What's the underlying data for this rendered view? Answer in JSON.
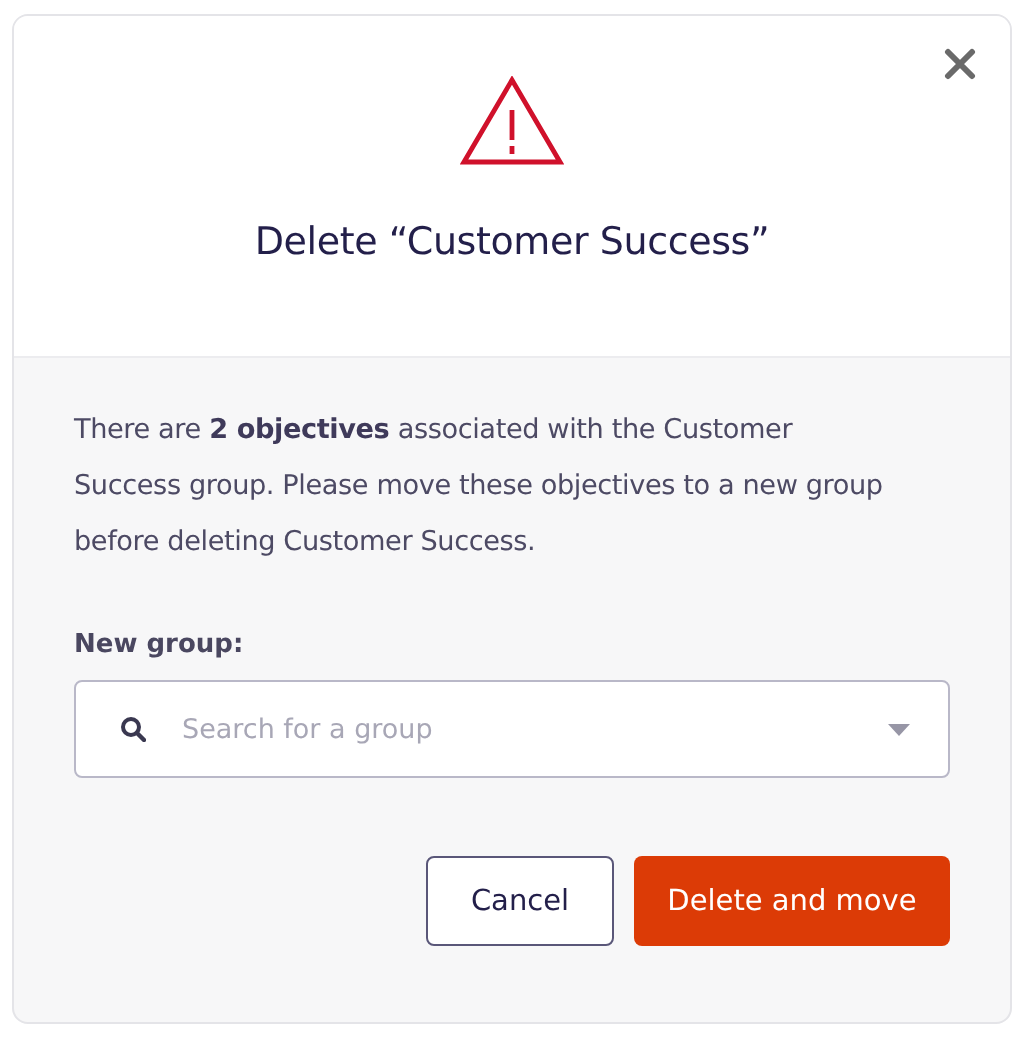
{
  "dialog": {
    "title": "Delete “Customer Success”",
    "message": "There are **2 objectives** associated with the Customer Success group. Please move these objectives to a new group before deleting Customer Success.",
    "field": {
      "label": "New group:",
      "placeholder": "Search for a group"
    },
    "buttons": [
      {
        "label": "Cancel",
        "kind": "secondary"
      },
      {
        "label": "Delete and move",
        "kind": "danger"
      }
    ]
  }
}
